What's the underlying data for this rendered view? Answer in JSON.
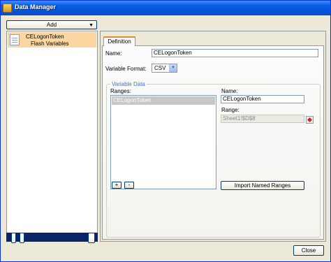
{
  "window": {
    "title": "Data Manager"
  },
  "left": {
    "add_label": "Add",
    "tree": [
      {
        "name": "CELogonToken",
        "type": "Flash Variables"
      }
    ],
    "bottom": {
      "up_label": "↑",
      "down_label": "↓",
      "delete_label": "✕"
    }
  },
  "tabs": [
    {
      "label": "Definition"
    }
  ],
  "definition": {
    "name_label": "Name:",
    "name_value": "CELogonToken",
    "format_label": "Variable Format:",
    "format_value": "CSV"
  },
  "variable_data": {
    "group_title": "Variable Data",
    "ranges_label": "Ranges:",
    "ranges": [
      "CELogonToken"
    ],
    "add_range_label": "+",
    "remove_range_label": "-",
    "name_label": "Name:",
    "name_value": "CELogonToken",
    "range_label": "Range:",
    "range_value": "Sheet1!$D$8",
    "import_label": "Import Named Ranges"
  },
  "footer": {
    "close_label": "Close"
  }
}
